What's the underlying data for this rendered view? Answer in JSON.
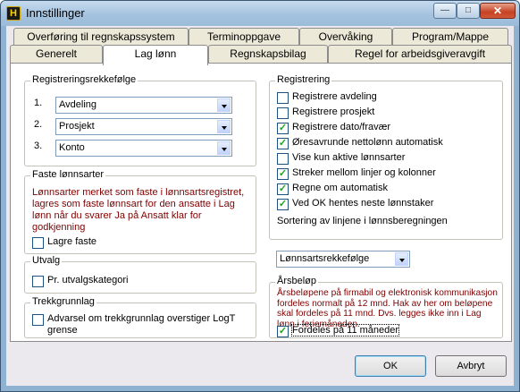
{
  "window": {
    "title": "Innstillinger",
    "app_icon": "H",
    "min_glyph": "—",
    "max_glyph": "□",
    "close_glyph": "✕"
  },
  "tabs_row1": [
    {
      "label": "Overføring til regnskapssystem"
    },
    {
      "label": "Terminoppgave"
    },
    {
      "label": "Overvåking"
    },
    {
      "label": "Program/Mappe"
    }
  ],
  "tabs_row2": [
    {
      "label": "Generelt"
    },
    {
      "label": "Lag lønn"
    },
    {
      "label": "Regnskapsbilag"
    },
    {
      "label": "Regel for arbeidsgiveravgift"
    }
  ],
  "registreringsrekkefolge": {
    "legend": "Registreringsrekkefølge",
    "rows": [
      {
        "num": "1.",
        "value": "Avdeling"
      },
      {
        "num": "2.",
        "value": "Prosjekt"
      },
      {
        "num": "3.",
        "value": "Konto"
      }
    ]
  },
  "faste_lonnsarter": {
    "legend": "Faste lønnsarter",
    "note": "Lønnsarter merket som faste i lønnsartsregistret, lagres som faste lønnsart for den ansatte i Lag lønn når du svarer Ja på Ansatt klar for godkjenning",
    "checkbox": {
      "label": "Lagre faste",
      "checked": false
    }
  },
  "utvalg": {
    "legend": "Utvalg",
    "checkbox": {
      "label": "Pr. utvalgskategori",
      "checked": false
    }
  },
  "trekkgrunnlag": {
    "legend": "Trekkgrunnlag",
    "checkbox": {
      "label_line1": "Advarsel om trekkgrunnlag overstiger LogT",
      "label_line2": "grense",
      "checked": false
    }
  },
  "registrering": {
    "legend": "Registrering",
    "items": [
      {
        "label": "Registrere avdeling",
        "checked": false
      },
      {
        "label": "Registrere  prosjekt",
        "checked": false
      },
      {
        "label": "Registrere  dato/fravær",
        "checked": true
      },
      {
        "label": "Øresavrunde nettolønn automatisk",
        "checked": true
      },
      {
        "label": "Vise kun aktive lønnsarter",
        "checked": false
      },
      {
        "label": "Streker mellom linjer og kolonner",
        "checked": true
      },
      {
        "label": "Regne om automatisk",
        "checked": true
      },
      {
        "label": "Ved OK hentes neste lønnstaker",
        "checked": true
      }
    ],
    "sort_label": "Sortering av linjene i lønnsberegningen",
    "sort_value": "Lønnsartsrekkefølge"
  },
  "arsbelop": {
    "legend": "Årsbeløp",
    "note": "Årsbeløpene på firmabil og elektronisk kommunikasjon fordeles normalt på 12 mnd.  Hak av her om beløpene skal fordeles på 11 mnd. Dvs. legges ikke inn i Lag lønn i feriemåneden.",
    "checkbox": {
      "label": "Fordeles på 11 måneder",
      "checked": true
    }
  },
  "buttons": {
    "ok": "OK",
    "cancel": "Avbryt"
  }
}
